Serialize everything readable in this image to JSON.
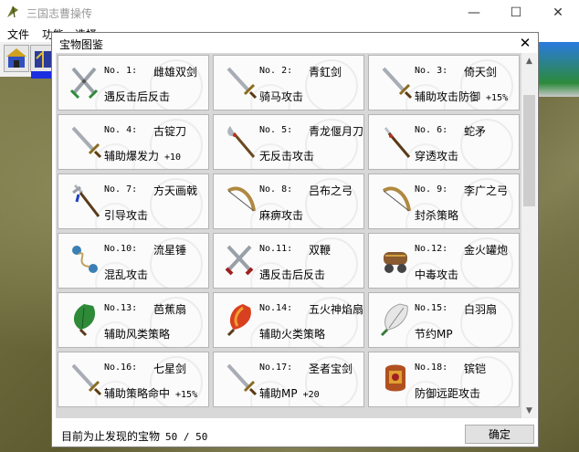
{
  "app": {
    "title": "三国志曹操传",
    "menu": [
      "文件",
      "功能",
      "选择"
    ]
  },
  "dialog": {
    "title": "宝物图鉴",
    "close_glyph": "✕",
    "ok_label": "确定",
    "footer_label": "目前为止发现的宝物",
    "footer_count": "50 / 50"
  },
  "items": [
    {
      "no": "No. 1:",
      "name": "雌雄双剑",
      "effect": "遇反击后反击",
      "pct": "",
      "icon": "crossed-swords-icon"
    },
    {
      "no": "No. 2:",
      "name": "青釭剑",
      "effect": "骑马攻击",
      "pct": "",
      "icon": "sword-icon"
    },
    {
      "no": "No. 3:",
      "name": "倚天剑",
      "effect": "辅助攻击防御",
      "pct": "+15%",
      "icon": "sword-icon"
    },
    {
      "no": "No. 4:",
      "name": "古锭刀",
      "effect": "辅助爆发力",
      "pct": "+10",
      "icon": "sword-icon"
    },
    {
      "no": "No. 5:",
      "name": "青龙偃月刀",
      "effect": "无反击攻击",
      "pct": "",
      "icon": "glaive-icon"
    },
    {
      "no": "No. 6:",
      "name": "蛇矛",
      "effect": "穿透攻击",
      "pct": "",
      "icon": "spear-icon"
    },
    {
      "no": "No. 7:",
      "name": "方天画戟",
      "effect": "引导攻击",
      "pct": "",
      "icon": "halberd-icon"
    },
    {
      "no": "No. 8:",
      "name": "吕布之弓",
      "effect": "麻痹攻击",
      "pct": "",
      "icon": "bow-icon"
    },
    {
      "no": "No. 9:",
      "name": "李广之弓",
      "effect": "封杀策略",
      "pct": "",
      "icon": "bow-icon"
    },
    {
      "no": "No.10:",
      "name": "流星锤",
      "effect": "混乱攻击",
      "pct": "",
      "icon": "meteor-hammer-icon"
    },
    {
      "no": "No.11:",
      "name": "双鞭",
      "effect": "遇反击后反击",
      "pct": "",
      "icon": "twin-whips-icon"
    },
    {
      "no": "No.12:",
      "name": "金火罐炮",
      "effect": "中毒攻击",
      "pct": "",
      "icon": "cannon-icon"
    },
    {
      "no": "No.13:",
      "name": "芭蕉扇",
      "effect": "辅助风类策略",
      "pct": "",
      "icon": "leaf-fan-icon"
    },
    {
      "no": "No.14:",
      "name": "五火神焰扇",
      "effect": "辅助火类策略",
      "pct": "",
      "icon": "fire-fan-icon"
    },
    {
      "no": "No.15:",
      "name": "白羽扇",
      "effect": "节约MP",
      "pct": "",
      "icon": "feather-fan-icon"
    },
    {
      "no": "No.16:",
      "name": "七星剑",
      "effect": "辅助策略命中",
      "pct": "+15%",
      "icon": "sword-icon"
    },
    {
      "no": "No.17:",
      "name": "圣者宝剑",
      "effect": "辅助MP",
      "pct": "+20",
      "icon": "sword-icon"
    },
    {
      "no": "No.18:",
      "name": "镔铠",
      "effect": "防御远距攻击",
      "pct": "",
      "icon": "armor-icon"
    }
  ],
  "colors": {
    "title_gray": "#999999",
    "scroll_thumb": "#cdcdcd",
    "game_blue": "#1b2ee0"
  }
}
